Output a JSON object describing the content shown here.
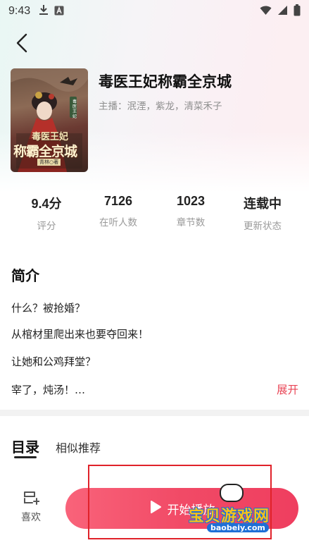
{
  "status_bar": {
    "time": "9:43"
  },
  "book": {
    "title": "毒医王妃称霸全京城",
    "narrators": "主播：泯湮，紫龙，清菜禾子",
    "cover": {
      "title_line1": "毒医王妃",
      "title_line2": "称霸全京城",
      "author": "青林○著",
      "side_tag": "毒医王妃"
    }
  },
  "stats": [
    {
      "value": "9.4分",
      "label": "评分"
    },
    {
      "value": "7126",
      "label": "在听人数"
    },
    {
      "value": "1023",
      "label": "章节数"
    },
    {
      "value": "连载中",
      "label": "更新状态"
    }
  ],
  "intro": {
    "heading": "简介",
    "lines": [
      "什么？被抢婚？",
      "从棺材里爬出来也要夺回来！",
      "让她和公鸡拜堂？",
      "宰了，炖汤！…"
    ],
    "expand_label": "展开"
  },
  "tabs": {
    "active": "目录",
    "other": "相似推荐"
  },
  "bottom_bar": {
    "like_label": "喜欢",
    "play_label": "开始播放"
  },
  "watermark": {
    "main": "宝贝游戏网",
    "url": "baobeiy.com"
  },
  "colors": {
    "accent": "#ef3e5f",
    "expand": "#e94556",
    "highlight_box": "#e0222a"
  }
}
